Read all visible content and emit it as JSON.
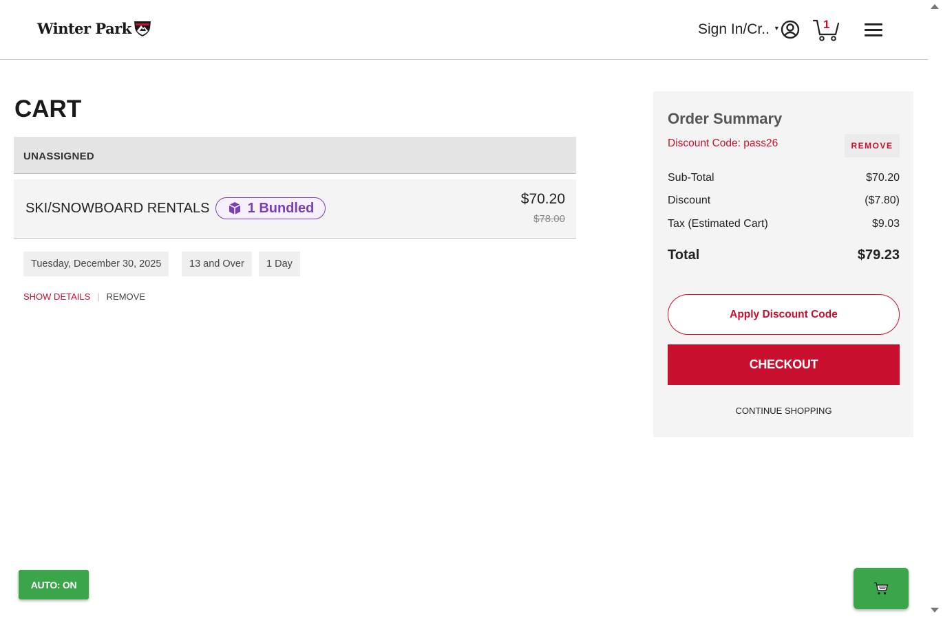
{
  "header": {
    "logo_text": "Winter Park",
    "signin_label": "Sign In/Cr..",
    "cart_count": "1",
    "icons": [
      "mountain-logo-icon",
      "user-circle-icon",
      "cart-icon",
      "hamburger-menu-icon"
    ]
  },
  "cart": {
    "title": "CART",
    "group_label": "UNASSIGNED",
    "item": {
      "name": "SKI/SNOWBOARD RENTALS",
      "bundle_label": "1 Bundled",
      "price": "$70.20",
      "original_price": "$78.00",
      "date": "Tuesday, December 30, 2025",
      "age": "13 and Over",
      "duration": "1 Day",
      "show_details": "SHOW DETAILS",
      "remove": "REMOVE"
    }
  },
  "summary": {
    "title": "Order Summary",
    "discount_code": "Discount Code: pass26",
    "remove_discount": "REMOVE",
    "rows": [
      {
        "label": "Sub-Total",
        "value": "$70.20"
      },
      {
        "label": "Discount",
        "value": "($7.80)"
      },
      {
        "label": "Tax (Estimated Cart)",
        "value": "$9.03"
      }
    ],
    "total": {
      "label": "Total",
      "value": "$79.23"
    },
    "apply_label": "Apply Discount Code",
    "checkout_label": "CHECKOUT",
    "continue_label": "CONTINUE SHOPPING"
  },
  "floating": {
    "auto_label": "AUTO: ON"
  },
  "colors": {
    "brand_red": "#c8102e",
    "bundle_purple": "#7a3fb0",
    "float_green": "#3ba54a"
  }
}
